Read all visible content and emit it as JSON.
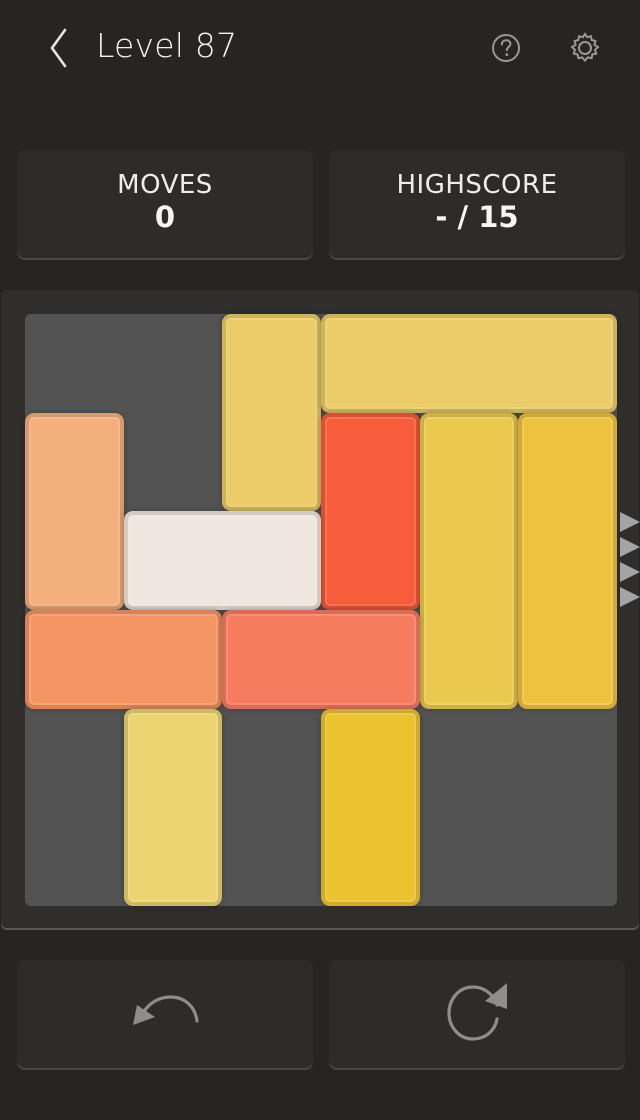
{
  "header": {
    "back_icon": "chevron-left-icon",
    "title": "Level 87",
    "help_icon": "help-circle-icon",
    "settings_icon": "gear-icon"
  },
  "stats": {
    "moves_label": "MOVES",
    "moves_value": "0",
    "highscore_label": "HIGHSCORE",
    "highscore_value": "- / 15"
  },
  "board": {
    "grid": 6,
    "exit_side": "right",
    "exit_row": 2,
    "background": "#535353",
    "blocks": [
      {
        "id": "block-1",
        "col": 2,
        "row": 0,
        "w": 1,
        "h": 2,
        "color": "#ebcc68"
      },
      {
        "id": "block-2",
        "col": 3,
        "row": 0,
        "w": 3,
        "h": 1,
        "color": "#ebcc68"
      },
      {
        "id": "block-3",
        "col": 0,
        "row": 1,
        "w": 1,
        "h": 2,
        "color": "#f4b07c"
      },
      {
        "id": "block-4",
        "col": 3,
        "row": 1,
        "w": 1,
        "h": 2,
        "color": "#f85d3b"
      },
      {
        "id": "block-5",
        "col": 4,
        "row": 1,
        "w": 1,
        "h": 3,
        "color": "#ebc94f"
      },
      {
        "id": "block-6",
        "col": 5,
        "row": 1,
        "w": 1,
        "h": 3,
        "color": "#ecc23f"
      },
      {
        "id": "block-player",
        "col": 1,
        "row": 2,
        "w": 2,
        "h": 1,
        "color": "#efe6df",
        "player": true
      },
      {
        "id": "block-7",
        "col": 0,
        "row": 3,
        "w": 2,
        "h": 1,
        "color": "#f59564"
      },
      {
        "id": "block-8",
        "col": 2,
        "row": 3,
        "w": 2,
        "h": 1,
        "color": "#f67c60"
      },
      {
        "id": "block-9",
        "col": 1,
        "row": 4,
        "w": 1,
        "h": 2,
        "color": "#ecd472"
      },
      {
        "id": "block-10",
        "col": 3,
        "row": 4,
        "w": 1,
        "h": 2,
        "color": "#ecc231"
      }
    ]
  },
  "controls": {
    "undo_icon": "undo-icon",
    "restart_icon": "restart-icon"
  }
}
